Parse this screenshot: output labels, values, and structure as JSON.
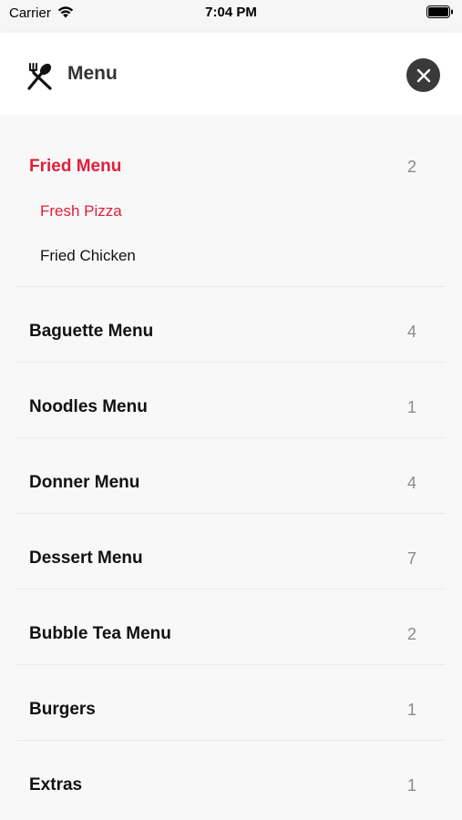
{
  "status_bar": {
    "carrier": "Carrier",
    "time": "7:04 PM"
  },
  "header": {
    "title": "Menu",
    "icon": "fork-spoon-icon",
    "close_icon": "close-icon"
  },
  "accent_color": "#e0203a",
  "categories": [
    {
      "label": "Fried Menu",
      "count": "2",
      "expanded": true,
      "active": true,
      "items": [
        {
          "label": "Fresh Pizza",
          "active": true
        },
        {
          "label": "Fried Chicken",
          "active": false
        }
      ]
    },
    {
      "label": "Baguette Menu",
      "count": "4"
    },
    {
      "label": "Noodles Menu",
      "count": "1"
    },
    {
      "label": "Donner Menu",
      "count": "4"
    },
    {
      "label": "Dessert Menu",
      "count": "7"
    },
    {
      "label": "Bubble Tea Menu",
      "count": "2"
    },
    {
      "label": "Burgers",
      "count": "1"
    },
    {
      "label": "Extras",
      "count": "1"
    }
  ]
}
